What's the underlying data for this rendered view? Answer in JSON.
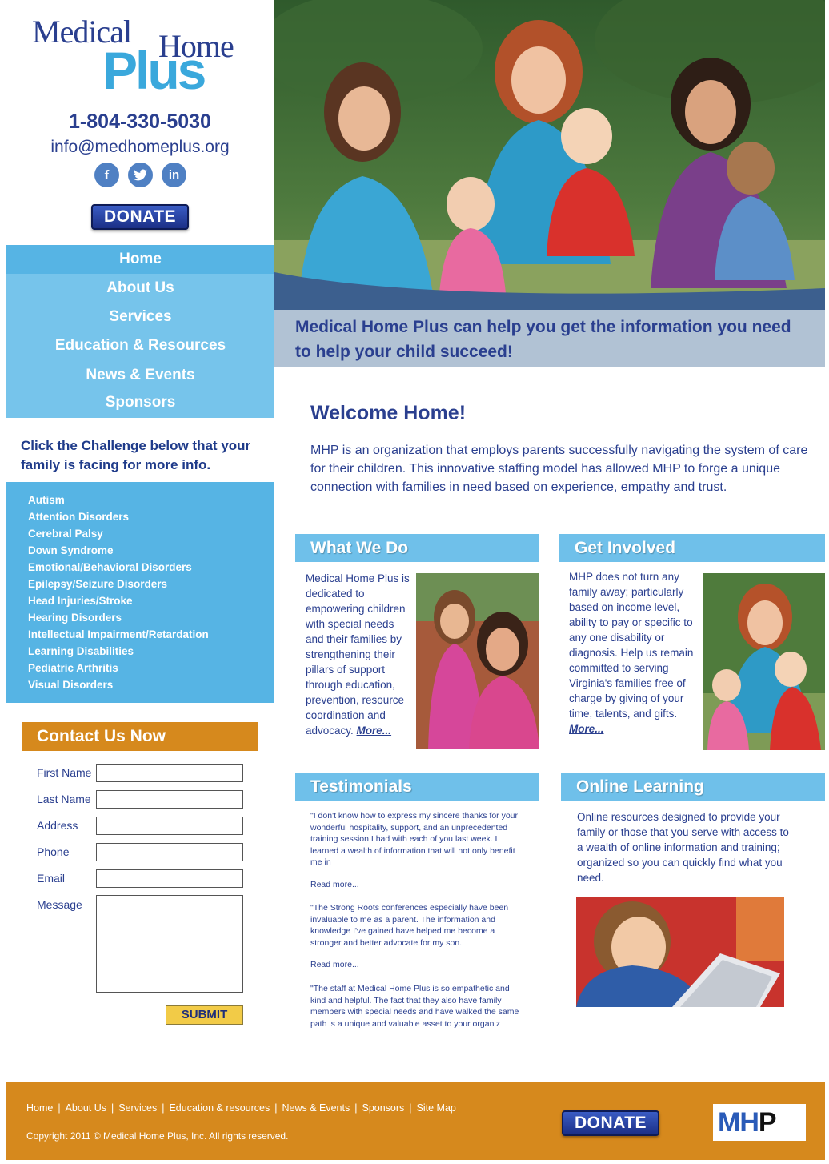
{
  "brand": {
    "logo_medical": "Medical",
    "logo_home": "Home",
    "logo_plus": "Plus",
    "phone": "1-804-330-5030",
    "email": "info@medhomeplus.org",
    "social": [
      "facebook-icon",
      "twitter-icon",
      "linkedin-icon"
    ],
    "donate_label": "DONATE",
    "colors": {
      "navy": "#2a3f8f",
      "sky": "#56b4e4",
      "orange": "#d6891d",
      "gold": "#f2cb47"
    }
  },
  "nav": {
    "items": [
      {
        "label": "Home"
      },
      {
        "label": "About Us"
      },
      {
        "label": "Services"
      },
      {
        "label": "Education & Resources"
      },
      {
        "label": "News & Events"
      },
      {
        "label": "Sponsors"
      }
    ]
  },
  "challenges": {
    "heading": "Click the Challenge below that your family is facing for more info.",
    "items": [
      "Autism",
      "Attention Disorders",
      "Cerebral Palsy",
      "Down Syndrome",
      "Emotional/Behavioral Disorders",
      "Epilepsy/Seizure Disorders",
      "Head Injuries/Stroke",
      "Hearing Disorders",
      "Intellectual Impairment/Retardation",
      "Learning Disabilities",
      "Pediatric Arthritis",
      "Visual Disorders"
    ]
  },
  "contact": {
    "heading": "Contact Us Now",
    "fields": [
      "First Name",
      "Last Name",
      "Address",
      "Phone",
      "Email"
    ],
    "message_label": "Message",
    "submit_label": "SUBMIT"
  },
  "hero": {
    "caption": "Medical Home Plus can help you get the information you need to help your child succeed!"
  },
  "welcome": {
    "title": "Welcome Home!",
    "text": "MHP is an organization that employs parents successfully navigating the system of care for their children.  This innovative staffing model has allowed MHP to forge a unique connection with families in need based on experience, empathy and trust."
  },
  "what_we_do": {
    "title": "What We Do",
    "text": "Medical Home Plus is dedicated to empowering children with special needs and their families by strengthening their pillars of support through education, prevention, resource coordination and advocacy.",
    "more": "More..."
  },
  "get_involved": {
    "title": "Get Involved",
    "text": "MHP does not turn any family away; particularly based on income level, ability to pay or specific to any one disability or diagnosis. Help us remain committed to serving Virginia's families free of charge by giving of your time, talents, and gifts.",
    "more": "More..."
  },
  "testimonials": {
    "title": "Testimonials",
    "items": [
      {
        "quote": "\"I don't know how to express my sincere thanks for your wonderful hospitality, support, and an unprecedented training session I had with each of you last week. I learned a wealth of information that will not only benefit me in",
        "more": "Read more..."
      },
      {
        "quote": "\"The Strong Roots conferences especially have been invaluable to me as a parent. The information and knowledge I've gained have helped me become a stronger and better advocate for my son.",
        "more": "Read more..."
      },
      {
        "quote": "\"The staff at Medical Home Plus is so empathetic and kind and helpful. The fact that they also have family members with special needs and have walked the same path is a unique and valuable asset to your organiz",
        "more": ""
      }
    ]
  },
  "online_learning": {
    "title": "Online Learning",
    "text": "Online resources designed to provide your family or those that you serve with access to a wealth of online information and training; organized so you can quickly find what you need."
  },
  "footer": {
    "links": [
      "Home",
      "About Us",
      "Services",
      "Education & resources",
      "News & Events",
      "Sponsors",
      "Site Map"
    ],
    "copyright": "Copyright 2011 © Medical Home Plus, Inc.  All rights reserved.",
    "donate_label": "DONATE",
    "logo_text": "MH",
    "logo_p": "P"
  }
}
